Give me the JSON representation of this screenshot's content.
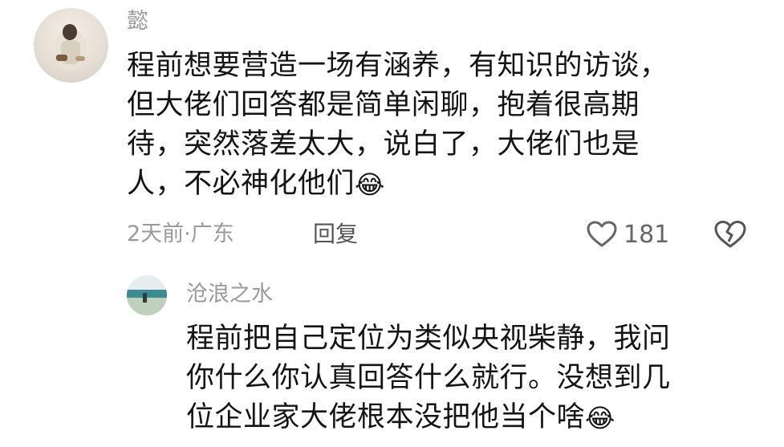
{
  "comment": {
    "username": "懿",
    "lines": [
      "程前想要营造一场有涵养，有知识的访谈，",
      "但大佬们回答都是简单闲聊，抱着很高期",
      "待，突然落差太大，说白了，大佬们也是",
      "人，不必神化他们"
    ],
    "emoji": "😂",
    "time_location": "2天前·广东",
    "reply_label": "回复",
    "like_count": "181"
  },
  "reply": {
    "username": "沧浪之水",
    "lines": [
      "程前把自己定位为类似央视柴静，我问",
      "你什么你认真回答什么就行。没想到几",
      "位企业家大佬根本没把他当个啥"
    ],
    "emoji": "😂"
  }
}
